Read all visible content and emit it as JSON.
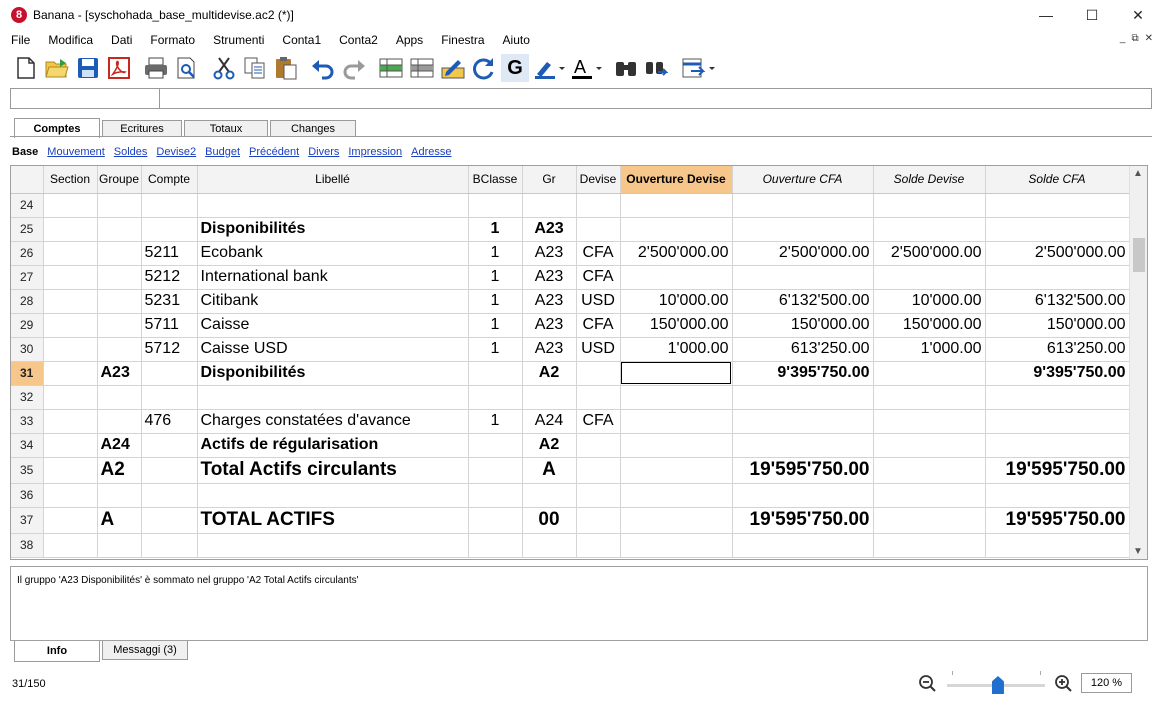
{
  "window": {
    "title": "Banana - [syschohada_base_multidevise.ac2 (*)]",
    "app_icon_glyph": "8"
  },
  "menu": [
    "File",
    "Modifica",
    "Dati",
    "Formato",
    "Strumenti",
    "Conta1",
    "Conta2",
    "Apps",
    "Finestra",
    "Aiuto"
  ],
  "toolbar": {
    "icons": [
      "new-file-icon",
      "open-folder-icon",
      "save-icon",
      "pdf-icon",
      "print-icon",
      "print-preview-icon",
      "cut-icon",
      "copy-icon",
      "paste-icon",
      "undo-icon",
      "redo-icon",
      "add-row-icon",
      "delete-row-icon",
      "edit-cell-icon",
      "recalculate-icon",
      "bold-icon",
      "highlighter-icon",
      "font-color-icon",
      "find-icon",
      "replace-icon",
      "export-icon"
    ],
    "bold_glyph": "G",
    "font_color_glyph": "A"
  },
  "formula": {
    "cell_ref": "",
    "content": ""
  },
  "tabs": [
    "Comptes",
    "Ecritures",
    "Totaux",
    "Changes"
  ],
  "active_tab": "Comptes",
  "views": [
    "Base",
    "Mouvement",
    "Soldes",
    "Devise2",
    "Budget",
    "Précédent",
    "Divers",
    "Impression",
    "Adresse"
  ],
  "active_view": "Base",
  "grid": {
    "columns": [
      "",
      "Section",
      "Groupe",
      "Compte",
      "Libellé",
      "BClasse",
      "Gr",
      "Devise",
      "Ouverture Devise",
      "Ouverture CFA",
      "Solde Devise",
      "Solde CFA"
    ],
    "selected_column": "Ouverture Devise",
    "rows": [
      {
        "n": "24",
        "section": "",
        "groupe": "",
        "compte": "",
        "libelle": "",
        "bclasse": "",
        "gr": "",
        "devise": "",
        "ouv_devise": "",
        "ouv_cfa": "",
        "solde_devise": "",
        "solde_cfa": "",
        "style": ""
      },
      {
        "n": "25",
        "section": "",
        "groupe": "",
        "compte": "",
        "libelle": "Disponibilités",
        "bclasse": "1",
        "gr": "A23",
        "devise": "",
        "ouv_devise": "",
        "ouv_cfa": "",
        "solde_devise": "",
        "solde_cfa": "",
        "style": "b"
      },
      {
        "n": "26",
        "section": "",
        "groupe": "",
        "compte": "5211",
        "libelle": "Ecobank",
        "bclasse": "1",
        "gr": "A23",
        "devise": "CFA",
        "ouv_devise": "2'500'000.00",
        "ouv_cfa": "2'500'000.00",
        "solde_devise": "2'500'000.00",
        "solde_cfa": "2'500'000.00",
        "style": ""
      },
      {
        "n": "27",
        "section": "",
        "groupe": "",
        "compte": "5212",
        "libelle": "International bank",
        "bclasse": "1",
        "gr": "A23",
        "devise": "CFA",
        "ouv_devise": "",
        "ouv_cfa": "",
        "solde_devise": "",
        "solde_cfa": "",
        "style": ""
      },
      {
        "n": "28",
        "section": "",
        "groupe": "",
        "compte": "5231",
        "libelle": "Citibank",
        "bclasse": "1",
        "gr": "A23",
        "devise": "USD",
        "ouv_devise": "10'000.00",
        "ouv_cfa": "6'132'500.00",
        "solde_devise": "10'000.00",
        "solde_cfa": "6'132'500.00",
        "style": ""
      },
      {
        "n": "29",
        "section": "",
        "groupe": "",
        "compte": "5711",
        "libelle": "Caisse",
        "bclasse": "1",
        "gr": "A23",
        "devise": "CFA",
        "ouv_devise": "150'000.00",
        "ouv_cfa": "150'000.00",
        "solde_devise": "150'000.00",
        "solde_cfa": "150'000.00",
        "style": ""
      },
      {
        "n": "30",
        "section": "",
        "groupe": "",
        "compte": "5712",
        "libelle": "Caisse USD",
        "bclasse": "1",
        "gr": "A23",
        "devise": "USD",
        "ouv_devise": "1'000.00",
        "ouv_cfa": "613'250.00",
        "solde_devise": "1'000.00",
        "solde_cfa": "613'250.00",
        "style": ""
      },
      {
        "n": "31",
        "section": "",
        "groupe": "A23",
        "compte": "",
        "libelle": "Disponibilités",
        "bclasse": "",
        "gr": "A2",
        "devise": "",
        "ouv_devise": "",
        "ouv_cfa": "9'395'750.00",
        "solde_devise": "",
        "solde_cfa": "9'395'750.00",
        "style": "b",
        "current": true
      },
      {
        "n": "32",
        "section": "",
        "groupe": "",
        "compte": "",
        "libelle": "",
        "bclasse": "",
        "gr": "",
        "devise": "",
        "ouv_devise": "",
        "ouv_cfa": "",
        "solde_devise": "",
        "solde_cfa": "",
        "style": ""
      },
      {
        "n": "33",
        "section": "",
        "groupe": "",
        "compte": "476",
        "libelle": "Charges constatées d'avance",
        "bclasse": "1",
        "gr": "A24",
        "devise": "CFA",
        "ouv_devise": "",
        "ouv_cfa": "",
        "solde_devise": "",
        "solde_cfa": "",
        "style": ""
      },
      {
        "n": "34",
        "section": "",
        "groupe": "A24",
        "compte": "",
        "libelle": "Actifs de régularisation",
        "bclasse": "",
        "gr": "A2",
        "devise": "",
        "ouv_devise": "",
        "ouv_cfa": "",
        "solde_devise": "",
        "solde_cfa": "",
        "style": "b"
      },
      {
        "n": "35",
        "section": "",
        "groupe": "A2",
        "compte": "",
        "libelle": "Total Actifs circulants",
        "bclasse": "",
        "gr": "A",
        "devise": "",
        "ouv_devise": "",
        "ouv_cfa": "19'595'750.00",
        "solde_devise": "",
        "solde_cfa": "19'595'750.00",
        "style": "xl"
      },
      {
        "n": "36",
        "section": "",
        "groupe": "",
        "compte": "",
        "libelle": "",
        "bclasse": "",
        "gr": "",
        "devise": "",
        "ouv_devise": "",
        "ouv_cfa": "",
        "solde_devise": "",
        "solde_cfa": "",
        "style": ""
      },
      {
        "n": "37",
        "section": "",
        "groupe": "A",
        "compte": "",
        "libelle": "TOTAL ACTIFS",
        "bclasse": "",
        "gr": "00",
        "devise": "",
        "ouv_devise": "",
        "ouv_cfa": "19'595'750.00",
        "solde_devise": "",
        "solde_cfa": "19'595'750.00",
        "style": "xl"
      },
      {
        "n": "38",
        "section": "",
        "groupe": "",
        "compte": "",
        "libelle": "",
        "bclasse": "",
        "gr": "",
        "devise": "",
        "ouv_devise": "",
        "ouv_cfa": "",
        "solde_devise": "",
        "solde_cfa": "",
        "style": ""
      }
    ]
  },
  "info": {
    "message": "Il gruppo 'A23 Disponibilités' è sommato nel gruppo 'A2 Total Actifs circulants'"
  },
  "bottom_tabs": [
    "Info",
    "Messaggi (3)"
  ],
  "status": {
    "position": "31/150",
    "zoom": "120 %",
    "zoom_level_fraction": 0.52
  },
  "colors": {
    "selected_header": "#f6c68a",
    "link": "#1a3fbf",
    "zoom_thumb": "#1e6fd0"
  }
}
